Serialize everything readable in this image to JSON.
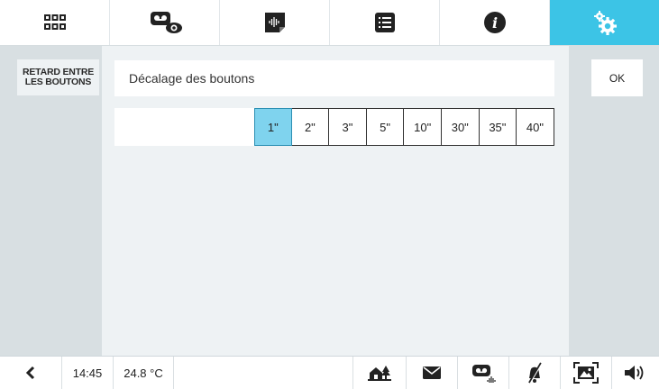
{
  "nav": {
    "tabs": [
      {
        "icon": "apps-grid-icon",
        "active": false
      },
      {
        "icon": "video-memo-view-icon",
        "active": false
      },
      {
        "icon": "voice-memo-icon",
        "active": false
      },
      {
        "icon": "list-icon",
        "active": false
      },
      {
        "icon": "info-icon",
        "active": false
      },
      {
        "icon": "settings-gears-icon",
        "active": true
      }
    ],
    "active_color": "#3cc4e6"
  },
  "sidebar": {
    "item_label": "RETARD ENTRE\nLES BOUTONS"
  },
  "main": {
    "field_label": "Décalage des boutons",
    "options": [
      "1\"",
      "2\"",
      "3\"",
      "5\"",
      "10\"",
      "30\"",
      "35\"",
      "40\""
    ],
    "selected_index": 0,
    "selected_color": "#7fd3ee"
  },
  "actions": {
    "ok_label": "OK"
  },
  "statusbar": {
    "time": "14:45",
    "temperature": "24.8 °C",
    "icons": [
      "back-arrow-icon",
      "home-scenario-icon",
      "mail-icon",
      "video-memo-audio-icon",
      "bell-muted-icon",
      "picture-frame-icon",
      "speaker-volume-icon"
    ]
  }
}
